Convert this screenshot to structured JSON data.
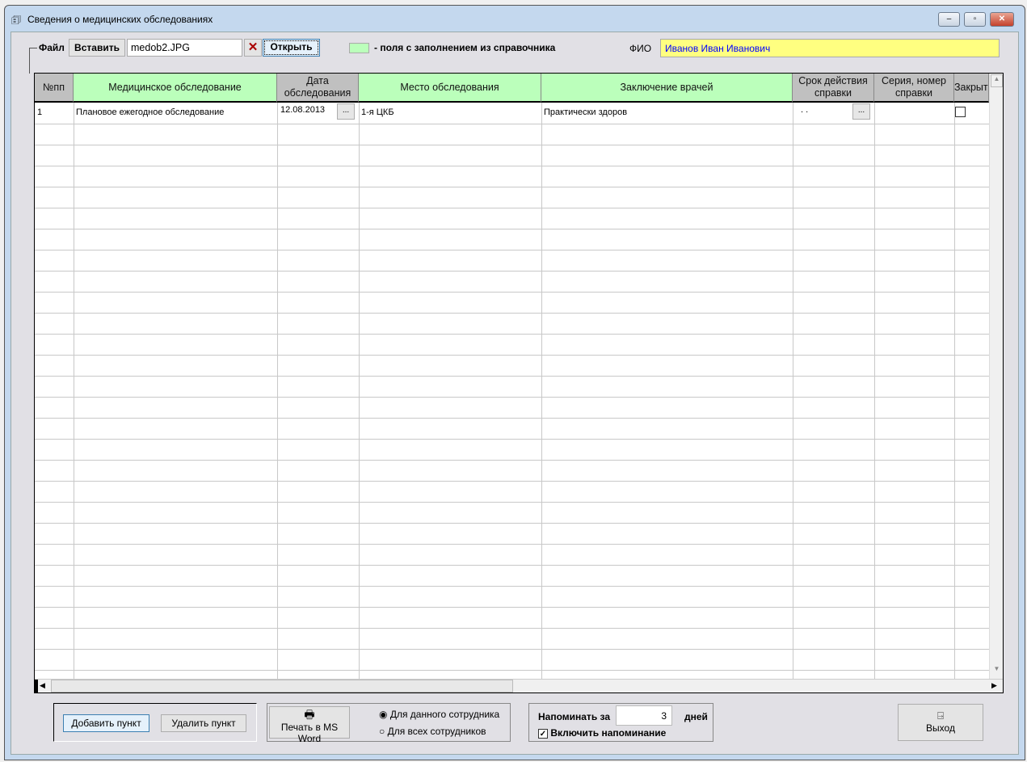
{
  "window": {
    "title": "Сведения о медицинских обследованиях",
    "minimize": "–",
    "maximize": "▫",
    "close": "✕"
  },
  "file": {
    "label": "Файл",
    "insert": "Вставить",
    "filename": "medob2.JPG",
    "clear": "✕",
    "open": "Открыть"
  },
  "legend": {
    "text": "- поля с заполнением из справочника",
    "color": "#bbffbb"
  },
  "fio": {
    "label": "ФИО",
    "value": "Иванов Иван Иванович"
  },
  "table": {
    "headers": [
      "№пп",
      "Медицинское обследование",
      "Дата обследования",
      "Место обследования",
      "Заключение врачей",
      "Срок действия справки",
      "Серия, номер справки",
      "Закрыт"
    ],
    "rows": [
      {
        "num": "1",
        "exam": "Плановое ежегодное обследование",
        "date": "12.08.2013",
        "place": "1-я ЦКБ",
        "conclusion": "Практически здоров",
        "validity": ". .",
        "series": ""
      }
    ],
    "date_button": "...",
    "validity_button": "..."
  },
  "buttons": {
    "add": "Добавить пункт",
    "delete": "Удалить пункт",
    "print": "Печать в MS Word",
    "exit": "Выход"
  },
  "print_options": {
    "current": "Для данного сотрудника",
    "all": "Для всех сотрудников",
    "selected": "current"
  },
  "reminder": {
    "label": "Напоминать за",
    "days": "3",
    "unit": "дней",
    "enable": "Включить напоминание",
    "enabled": true
  }
}
